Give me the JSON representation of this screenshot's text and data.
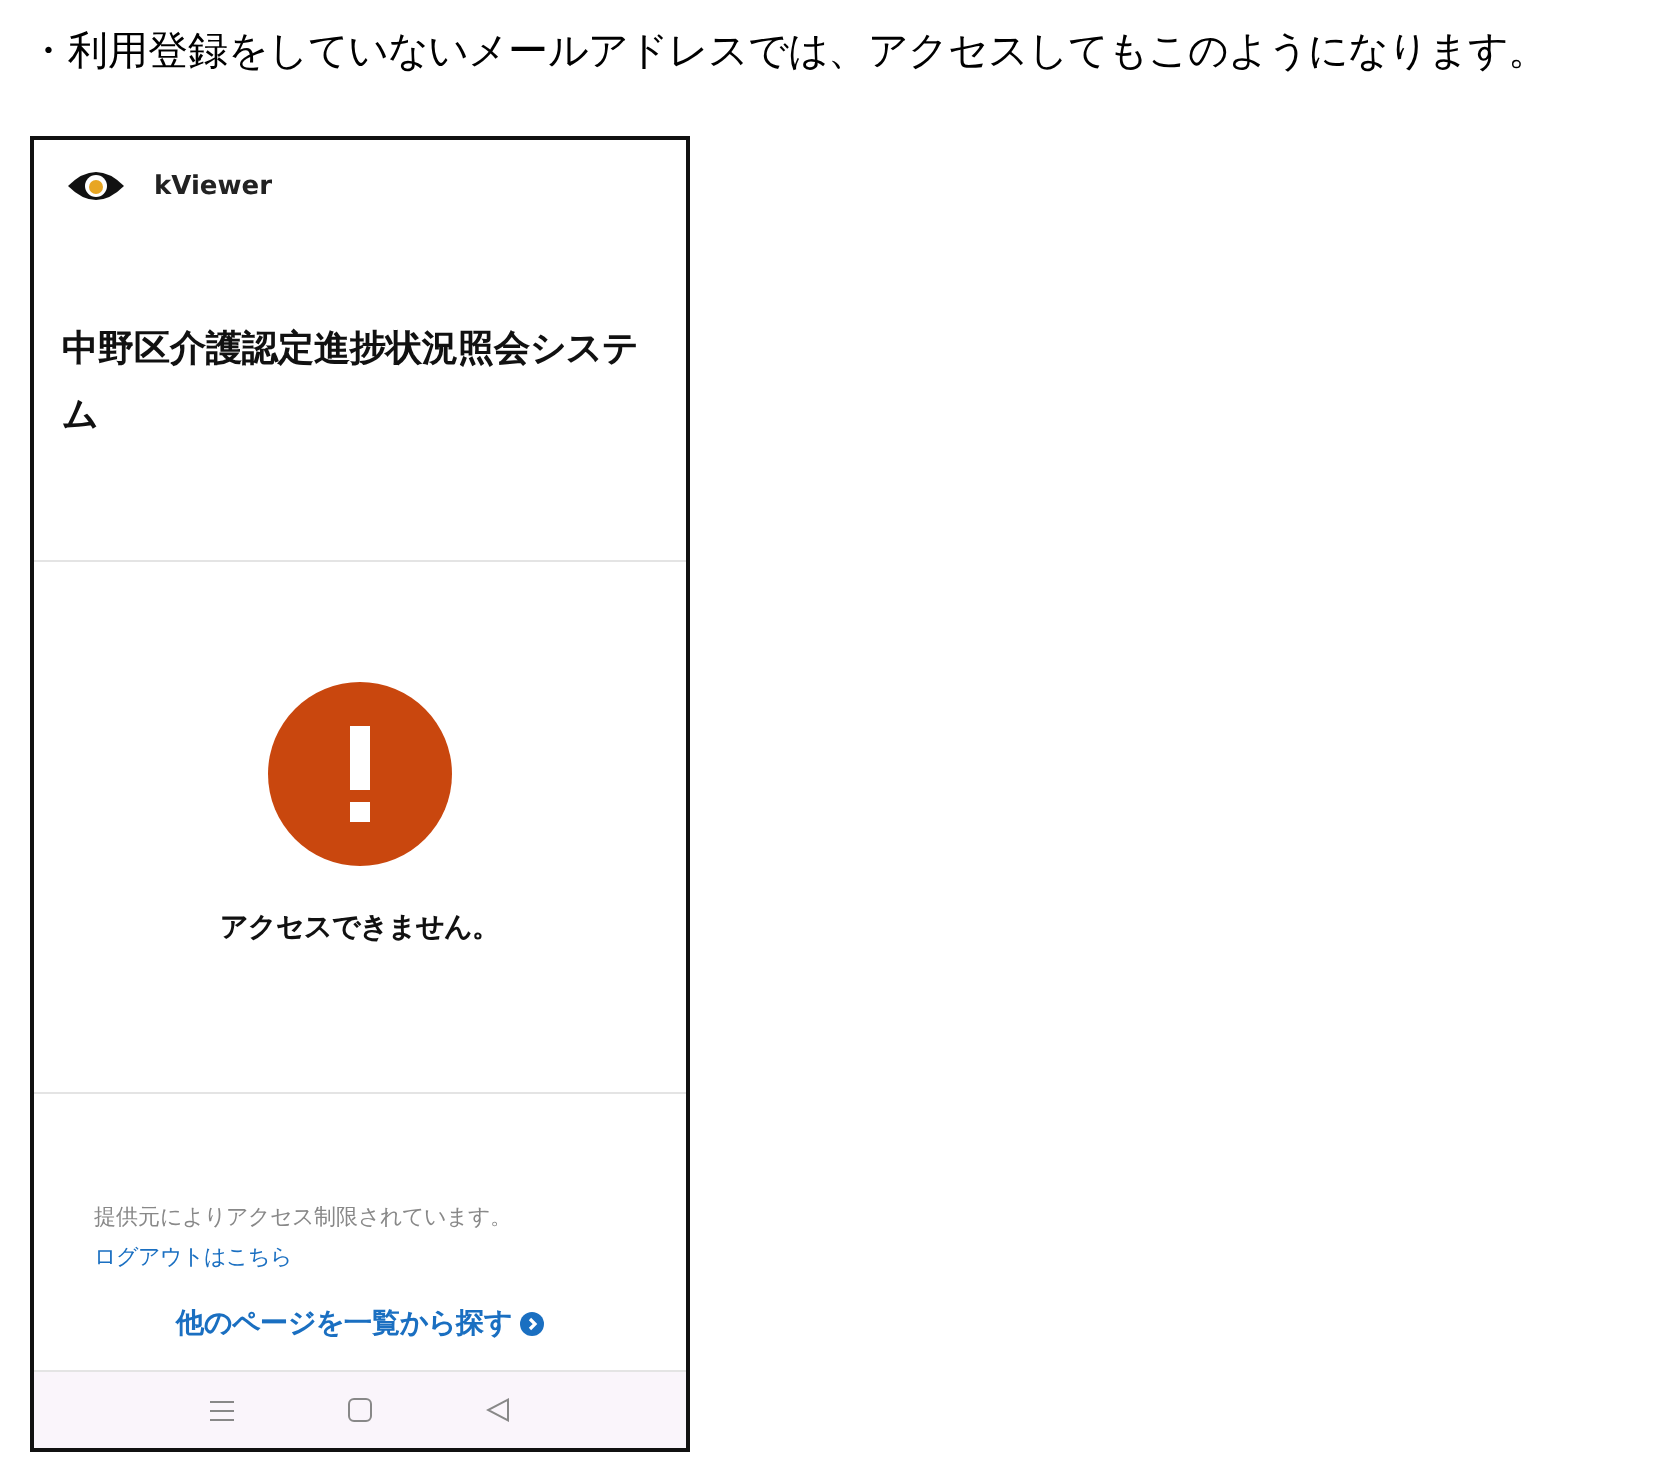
{
  "caption": "・利用登録をしていないメールアドレスでは、アクセスしてもこのようになります。",
  "phone": {
    "app_name": "kViewer",
    "page_title": "中野区介護認定進捗状況照会システム",
    "error_message": "アクセスできません。",
    "notice": {
      "text": "提供元によりアクセス制限されています。",
      "link": "ログアウトはこちら"
    },
    "browse_link": "他のページを一覧から探す"
  }
}
